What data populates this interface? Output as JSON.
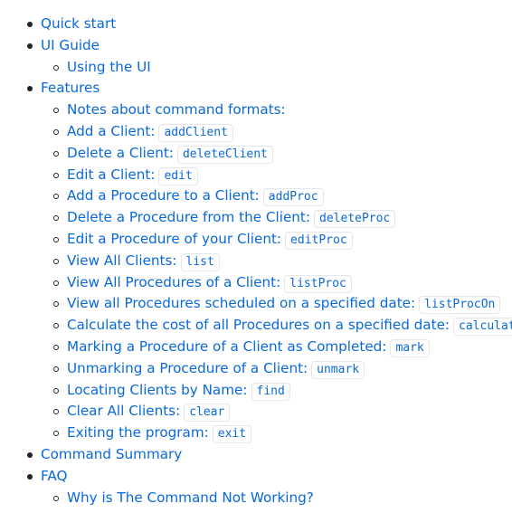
{
  "toc": {
    "quick_start": "Quick start",
    "ui_guide": {
      "label": "UI Guide",
      "children": {
        "using_ui": "Using the UI"
      }
    },
    "features": {
      "label": "Features",
      "children": {
        "notes": "Notes about command formats:",
        "add_client": {
          "label": "Add a Client:",
          "cmd": "addClient"
        },
        "delete_client": {
          "label": "Delete a Client:",
          "cmd": "deleteClient"
        },
        "edit_client": {
          "label": "Edit a Client:",
          "cmd": "edit"
        },
        "add_proc": {
          "label": "Add a Procedure to a Client:",
          "cmd": "addProc"
        },
        "delete_proc": {
          "label": "Delete a Procedure from the Client:",
          "cmd": "deleteProc"
        },
        "edit_proc": {
          "label": "Edit a Procedure of your Client:",
          "cmd": "editProc"
        },
        "list": {
          "label": "View All Clients:",
          "cmd": "list"
        },
        "list_proc": {
          "label": "View All Procedures of a Client:",
          "cmd": "listProc"
        },
        "list_proc_on": {
          "label": "View all Procedures scheduled on a specified date:",
          "cmd": "listProcOn"
        },
        "calculate": {
          "label": "Calculate the cost of all Procedures on a specified date:",
          "cmd": "calculate"
        },
        "mark": {
          "label": "Marking a Procedure of a Client as Completed:",
          "cmd": "mark"
        },
        "unmark": {
          "label": "Unmarking a Procedure of a Client:",
          "cmd": "unmark"
        },
        "find": {
          "label": "Locating Clients by Name:",
          "cmd": "find"
        },
        "clear": {
          "label": "Clear All Clients:",
          "cmd": "clear"
        },
        "exit": {
          "label": "Exiting the program:",
          "cmd": "exit"
        }
      }
    },
    "command_summary": "Command Summary",
    "faq": {
      "label": "FAQ",
      "children": {
        "why_not_working": "Why is The Command Not Working?"
      }
    }
  },
  "colors": {
    "link": "#0969da",
    "bullet": "#1f2328",
    "code_border": "#e3e6ea"
  }
}
